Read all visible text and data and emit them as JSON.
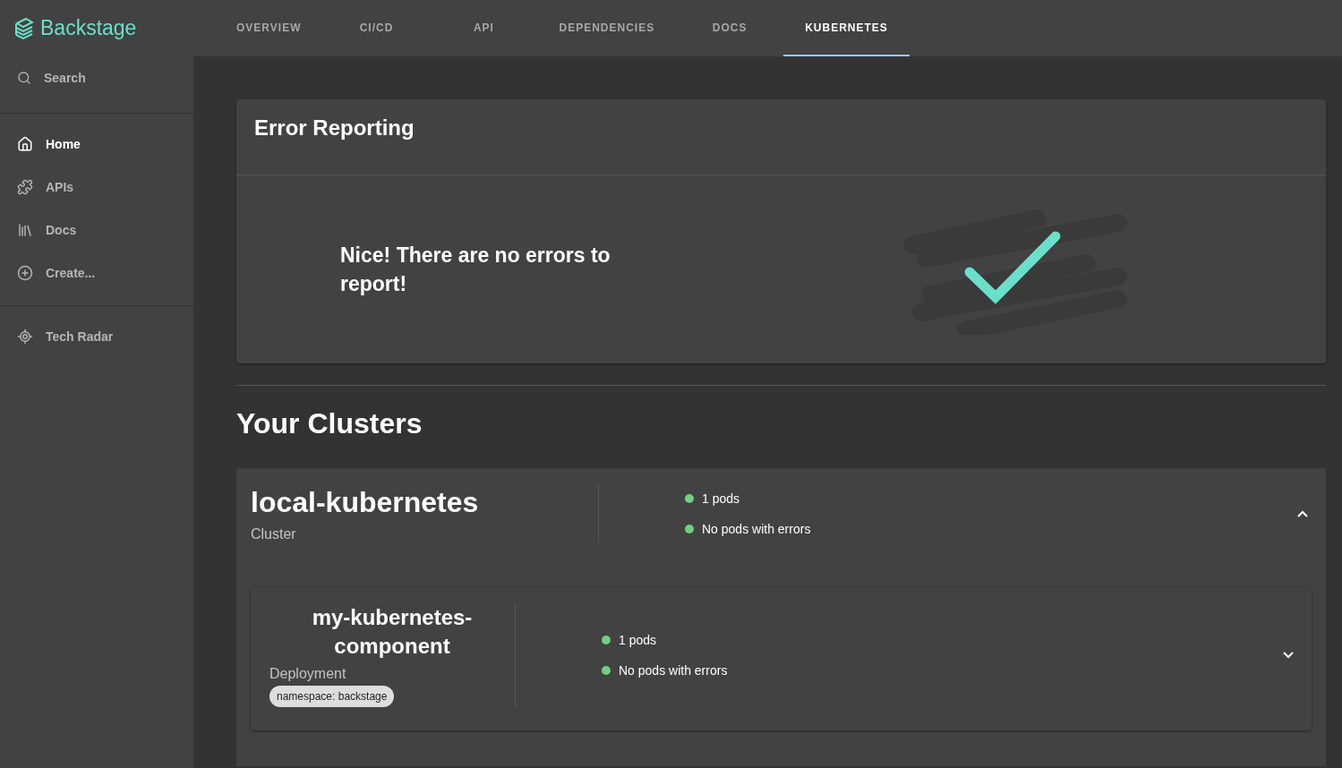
{
  "sidebar": {
    "logo": "Backstage",
    "search": {
      "label": "Search"
    },
    "items": [
      {
        "label": "Home",
        "selected": true
      },
      {
        "label": "APIs",
        "selected": false
      },
      {
        "label": "Docs",
        "selected": false
      },
      {
        "label": "Create...",
        "selected": false
      }
    ],
    "bottom_items": [
      {
        "label": "Tech Radar",
        "selected": false
      }
    ]
  },
  "tabs": [
    {
      "label": "OVERVIEW",
      "selected": false
    },
    {
      "label": "CI/CD",
      "selected": false
    },
    {
      "label": "API",
      "selected": false
    },
    {
      "label": "DEPENDENCIES",
      "selected": false
    },
    {
      "label": "DOCS",
      "selected": false
    },
    {
      "label": "KUBERNETES",
      "selected": true
    }
  ],
  "error_reporting": {
    "title": "Error Reporting",
    "message": "Nice! There are no errors to report!"
  },
  "clusters_heading": "Your Clusters",
  "clusters": [
    {
      "name": "local-kubernetes",
      "type": "Cluster",
      "expanded": true,
      "status": [
        "1 pods",
        "No pods with errors"
      ],
      "deployments": [
        {
          "name": "my-kubernetes-component",
          "type": "Deployment",
          "tag": "namespace: backstage",
          "expanded": false,
          "status": [
            "1 pods",
            "No pods with errors"
          ]
        }
      ]
    }
  ]
}
